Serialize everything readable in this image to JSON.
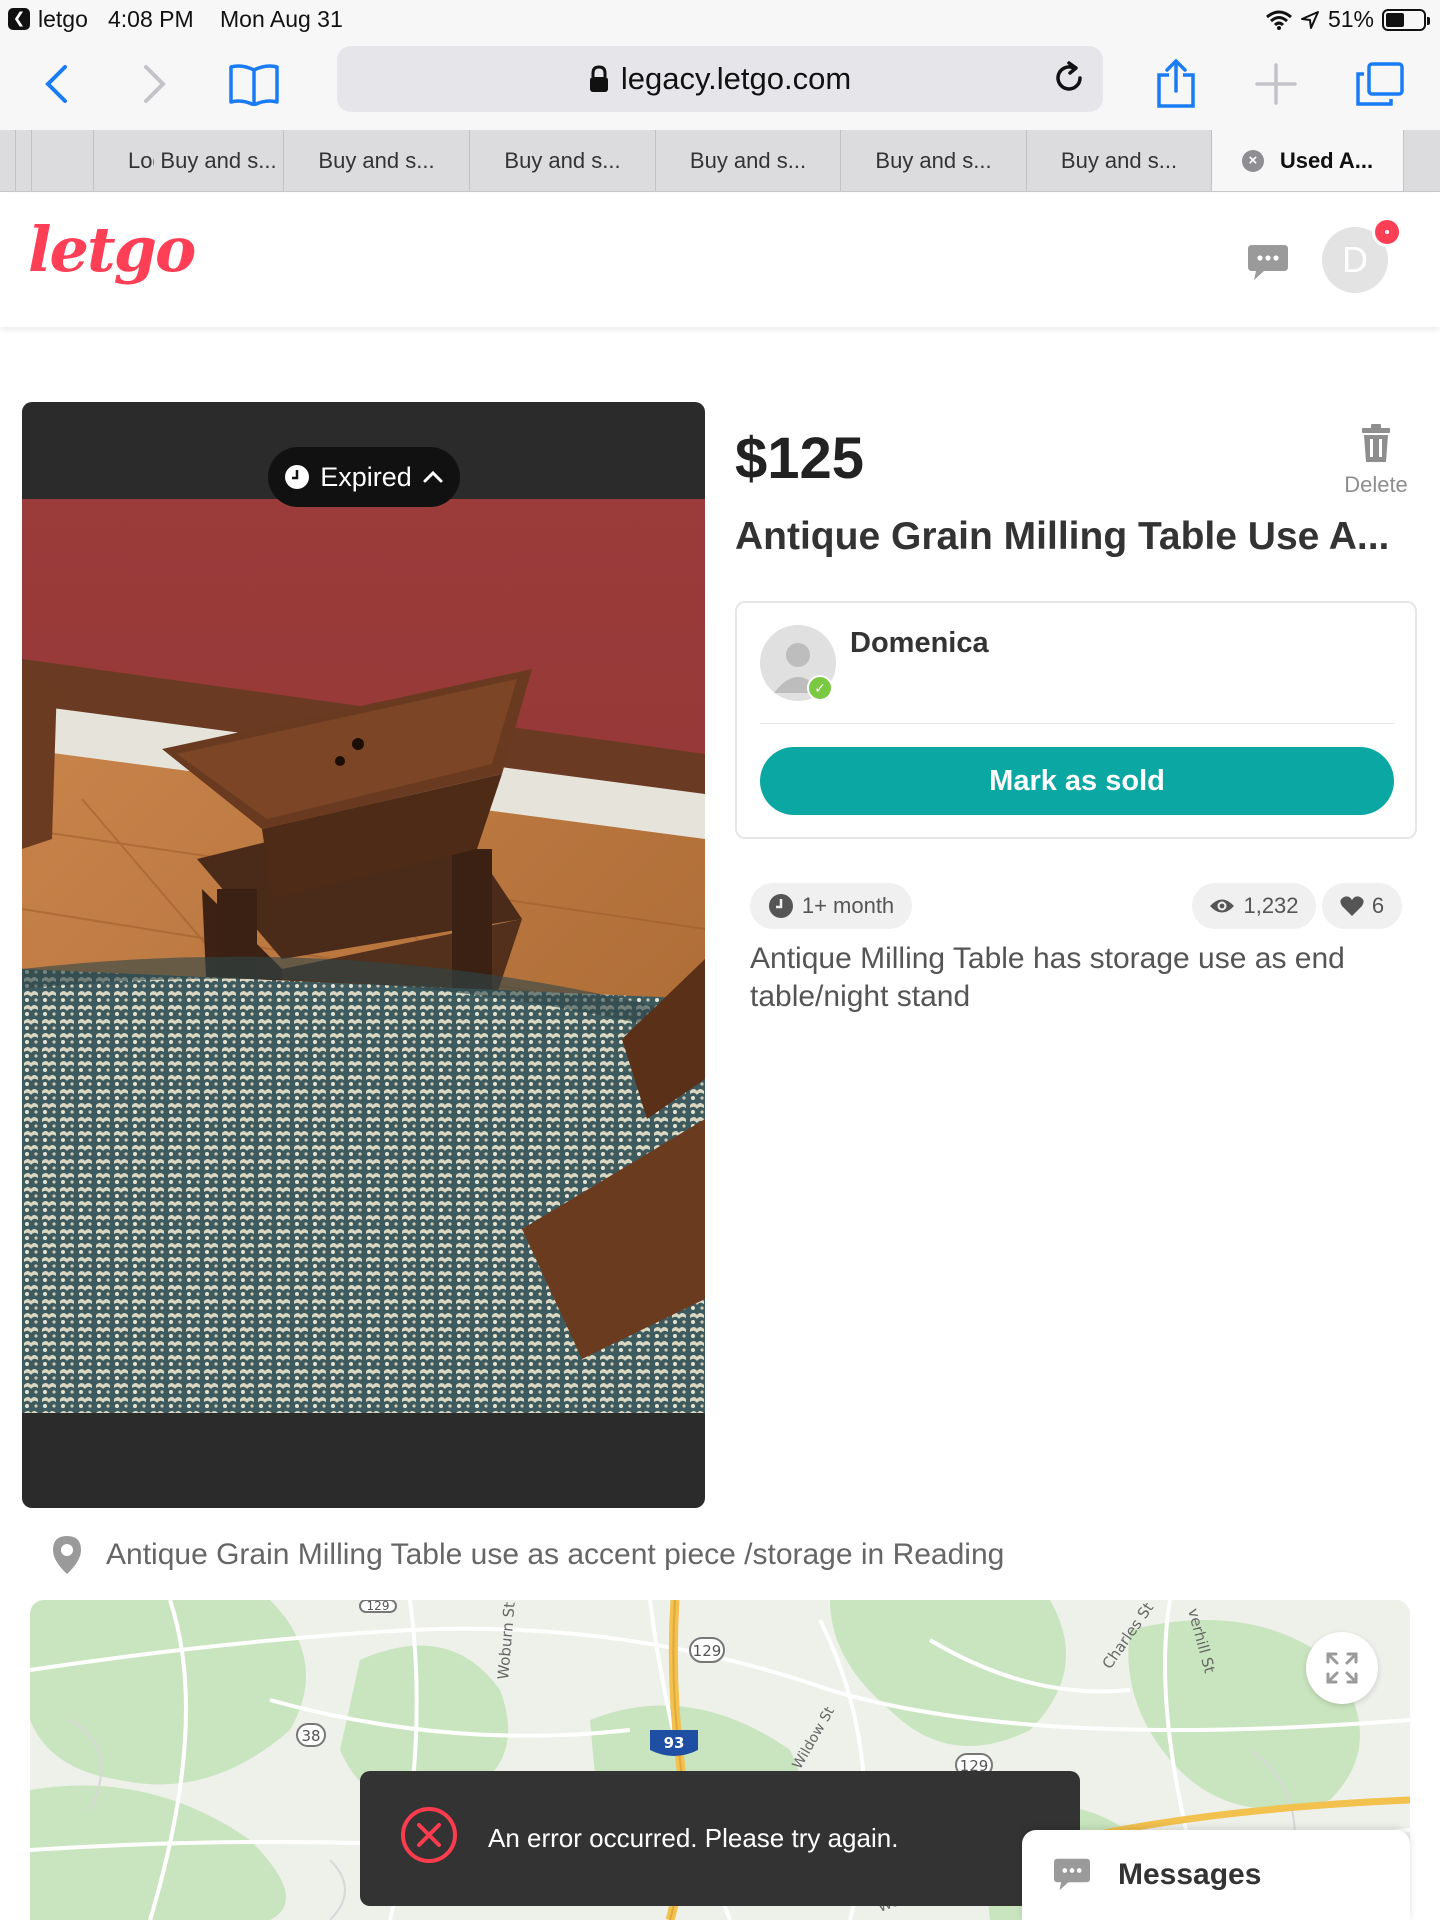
{
  "status_bar": {
    "app": "letgo",
    "time": "4:08 PM",
    "date": "Mon Aug 31",
    "battery": "51%",
    "battery_level": 0.51
  },
  "browser": {
    "url": "legacy.letgo.com",
    "tabs": [
      "Log",
      "Buy and s...",
      "Buy and s...",
      "Buy and s...",
      "Buy and s...",
      "Buy and s...",
      "Buy and s...",
      "Used A..."
    ],
    "active_tab_index": 7
  },
  "header": {
    "logo": "letgo",
    "avatar_initial": "D"
  },
  "listing": {
    "status_badge": "Expired",
    "price": "$125",
    "delete_label": "Delete",
    "title": "Antique Grain Milling Table Use A...",
    "age": "1+ month",
    "views": "1,232",
    "likes": "6",
    "description": "Antique Milling Table has storage use as end table/night stand",
    "location": "Antique Grain Milling Table use as accent piece /storage in Reading"
  },
  "seller": {
    "name": "Domenica",
    "mark_sold_label": "Mark as sold"
  },
  "map": {
    "labels": [
      "Woburn St",
      "Charles St",
      "verhill St",
      "Wildow St",
      "Woburn St"
    ],
    "shields": [
      "38",
      "129",
      "93",
      "129",
      "129"
    ]
  },
  "toast": {
    "message": "An error occurred. Please try again."
  },
  "messages_widget": {
    "label": "Messages"
  },
  "colors": {
    "brand": "#ff3f55",
    "accent": "#0aa7a3",
    "toast_bg": "#333333",
    "error": "#ff3b4e"
  }
}
